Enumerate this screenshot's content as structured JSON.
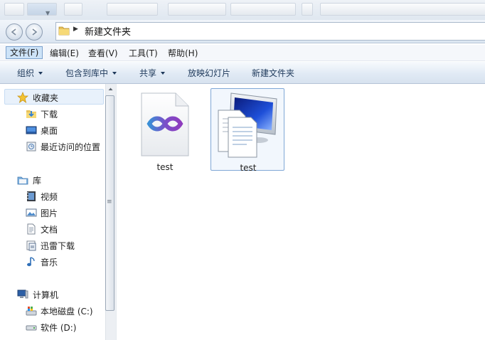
{
  "address": {
    "path_segment": "新建文件夹"
  },
  "menu": {
    "items": [
      {
        "label": "文件(F)"
      },
      {
        "label": "编辑(E)"
      },
      {
        "label": "查看(V)"
      },
      {
        "label": "工具(T)"
      },
      {
        "label": "帮助(H)"
      }
    ]
  },
  "toolbar": {
    "organize": "组织",
    "include_in_library": "包含到库中",
    "share": "共享",
    "slideshow": "放映幻灯片",
    "new_folder": "新建文件夹"
  },
  "nav": {
    "favorites": {
      "label": "收藏夹",
      "icon": "star-icon",
      "items": [
        {
          "label": "下载",
          "icon": "download-folder-icon"
        },
        {
          "label": "桌面",
          "icon": "desktop-icon"
        },
        {
          "label": "最近访问的位置",
          "icon": "recent-places-icon"
        }
      ]
    },
    "libraries": {
      "label": "库",
      "icon": "library-icon",
      "items": [
        {
          "label": "视频",
          "icon": "video-icon"
        },
        {
          "label": "图片",
          "icon": "pictures-icon"
        },
        {
          "label": "文档",
          "icon": "documents-icon"
        },
        {
          "label": "迅雷下载",
          "icon": "thunder-download-icon"
        },
        {
          "label": "音乐",
          "icon": "music-icon"
        }
      ]
    },
    "computer": {
      "label": "计算机",
      "icon": "computer-icon",
      "items": [
        {
          "label": "本地磁盘 (C:)",
          "icon": "system-drive-icon"
        },
        {
          "label": "软件 (D:)",
          "icon": "drive-icon"
        }
      ]
    }
  },
  "files": [
    {
      "name": "test",
      "icon": "visual-studio-file-icon",
      "selected": false
    },
    {
      "name": "test",
      "icon": "remote-desktop-file-icon",
      "selected": true
    }
  ],
  "colors": {
    "selection_border": "#7fa7d6",
    "selection_fill": "#f2f7fd",
    "command_text": "#1e395b"
  }
}
